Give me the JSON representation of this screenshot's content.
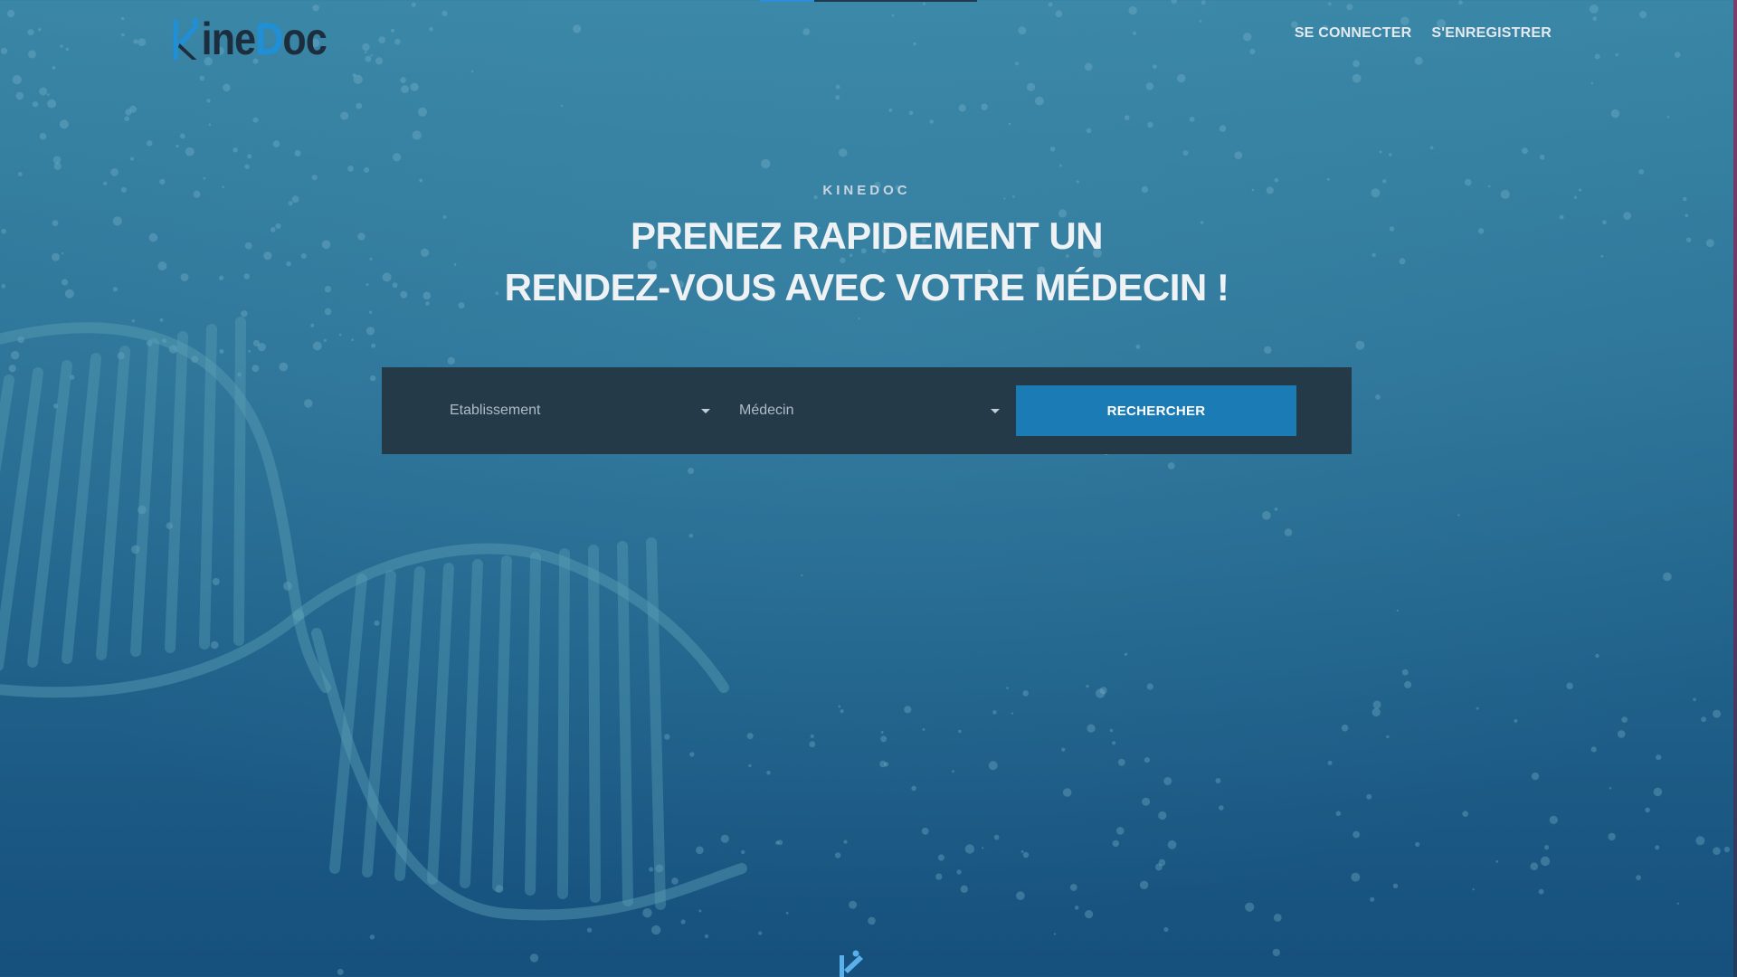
{
  "header": {
    "logo": {
      "part1": "ine",
      "part2": "D",
      "part3": "oc",
      "alt": "KineDoc"
    },
    "nav": [
      {
        "label": "SE CONNECTER"
      },
      {
        "label": "S'ENREGISTRER"
      }
    ]
  },
  "page_loading": {
    "progress": 0.25
  },
  "hero": {
    "eyebrow": "KINEDOC",
    "title_line1": "PRENEZ RAPIDEMENT UN",
    "title_line2": "RENDEZ-VOUS AVEC VOTRE MÉDECIN !"
  },
  "search": {
    "establishment": {
      "selected": "Etablissement"
    },
    "doctor": {
      "selected": "Médecin"
    },
    "submit_label": "RECHERCHER"
  },
  "colors": {
    "accent": "#1a7bb5",
    "logo_blue": "#1f8fd8",
    "logo_dark": "#1c2e3e",
    "panel": "#243a48"
  },
  "icons": {
    "logo_mark": "kinedoc-k-logo-icon",
    "dropdown": "caret-down-icon",
    "footer_mark": "kinedoc-k-logo-icon"
  }
}
